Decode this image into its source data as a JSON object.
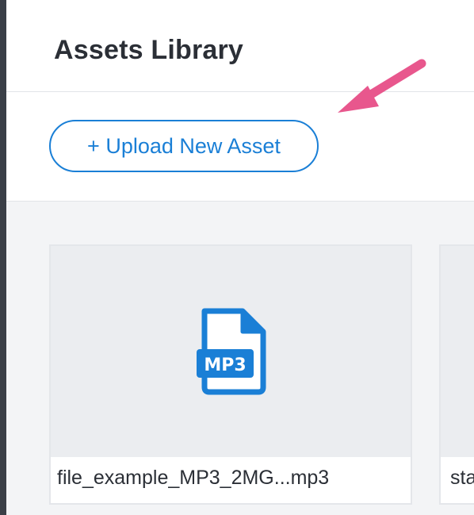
{
  "header": {
    "title": "Assets Library"
  },
  "toolbar": {
    "upload_label": "+ Upload New Asset"
  },
  "assets": [
    {
      "name": "file_example_MP3_2MG...mp3",
      "icon": "mp3-file-icon",
      "badge": "MP3"
    },
    {
      "name": "sta"
    }
  ],
  "colors": {
    "accent": "#1a7fd6",
    "annotation_arrow": "#e8578d",
    "thumb_bg": "#ebedf0",
    "content_bg": "#f3f4f6"
  }
}
